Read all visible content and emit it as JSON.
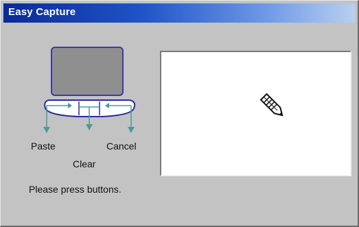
{
  "window": {
    "title": "Easy Capture"
  },
  "device": {
    "buttons": {
      "paste_label": "Paste",
      "clear_label": "Clear",
      "cancel_label": "Cancel"
    }
  },
  "status": {
    "message": "Please press buttons."
  },
  "signature_pad": {
    "cursor_icon": "pen-cursor-icon"
  },
  "colors": {
    "titlebar_start": "#0a2a96",
    "titlebar_end": "#b9cff2",
    "window_bg": "#c3c3c3",
    "arrow_teal": "#4a9a9a",
    "device_outline": "#2b2b9a"
  }
}
